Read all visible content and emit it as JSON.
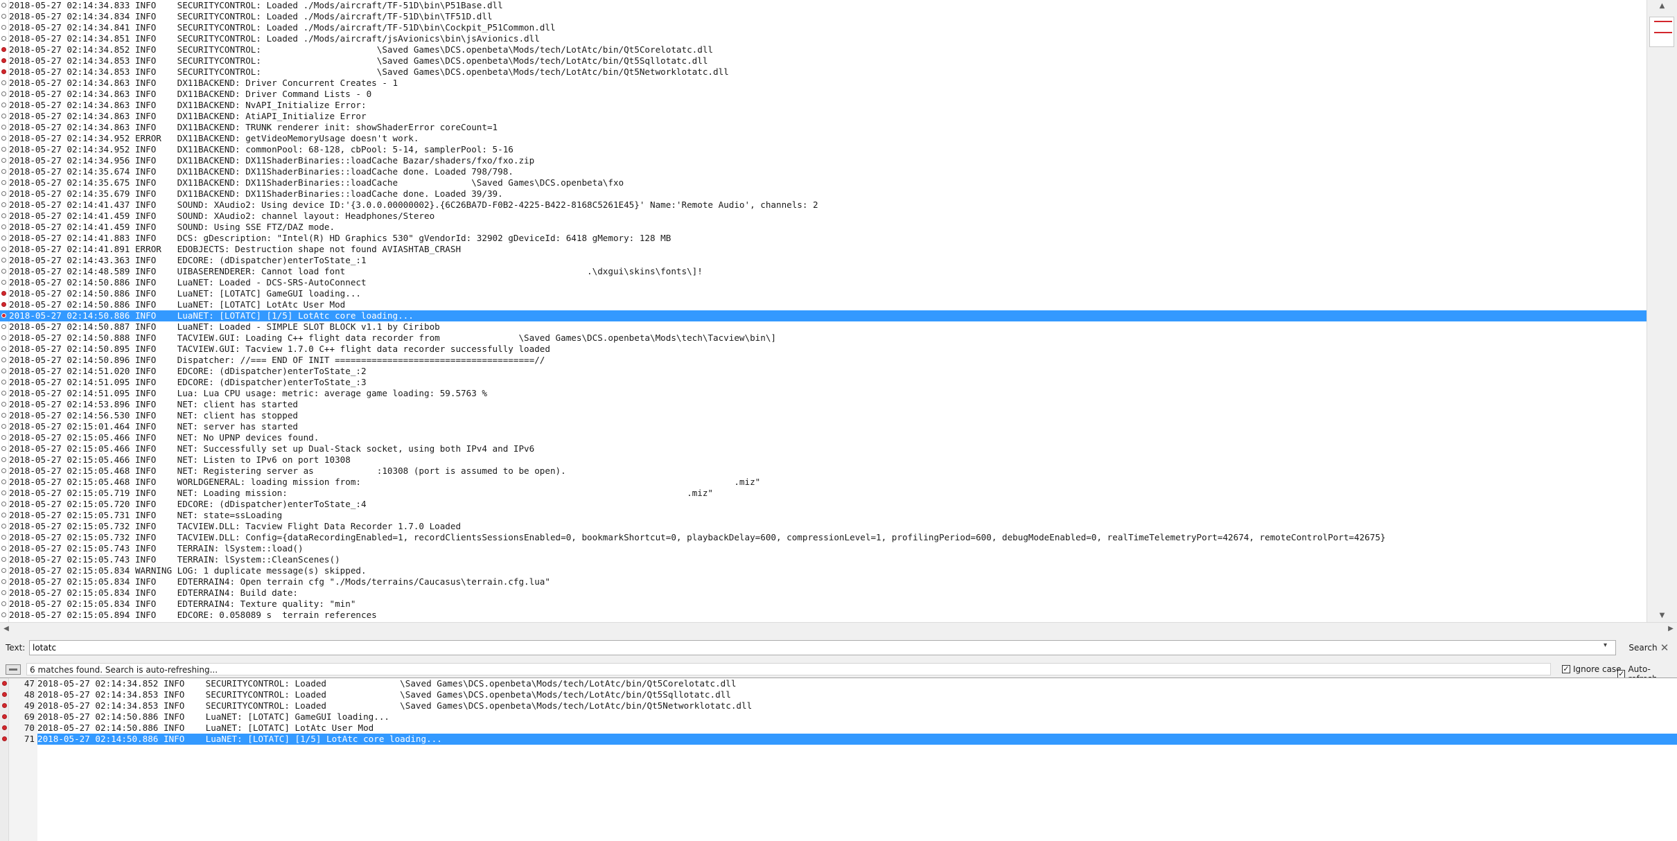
{
  "log": {
    "lines": [
      {
        "t": "2018-05-27 02:14:34.833 INFO    SECURITYCONTROL: Loaded ./Mods/aircraft/TF-51D\\bin\\P51Base.dll",
        "m": false
      },
      {
        "t": "2018-05-27 02:14:34.834 INFO    SECURITYCONTROL: Loaded ./Mods/aircraft/TF-51D\\bin\\TF51D.dll",
        "m": false
      },
      {
        "t": "2018-05-27 02:14:34.841 INFO    SECURITYCONTROL: Loaded ./Mods/aircraft/TF-51D\\bin\\Cockpit_P51Common.dll",
        "m": false
      },
      {
        "t": "2018-05-27 02:14:34.851 INFO    SECURITYCONTROL: Loaded ./Mods/aircraft/jsAvionics\\bin\\jsAvionics.dll",
        "m": false
      },
      {
        "t": "2018-05-27 02:14:34.852 INFO    SECURITYCONTROL:                      \\Saved Games\\DCS.openbeta\\Mods/tech/LotAtc/bin/Qt5Corelotatc.dll",
        "m": true
      },
      {
        "t": "2018-05-27 02:14:34.853 INFO    SECURITYCONTROL:                      \\Saved Games\\DCS.openbeta\\Mods/tech/LotAtc/bin/Qt5Sqllotatc.dll",
        "m": true
      },
      {
        "t": "2018-05-27 02:14:34.853 INFO    SECURITYCONTROL:                      \\Saved Games\\DCS.openbeta\\Mods/tech/LotAtc/bin/Qt5Networklotatc.dll",
        "m": true
      },
      {
        "t": "2018-05-27 02:14:34.863 INFO    DX11BACKEND: Driver Concurrent Creates - 1",
        "m": false
      },
      {
        "t": "2018-05-27 02:14:34.863 INFO    DX11BACKEND: Driver Command Lists - 0",
        "m": false
      },
      {
        "t": "2018-05-27 02:14:34.863 INFO    DX11BACKEND: NvAPI_Initialize Error:",
        "m": false
      },
      {
        "t": "2018-05-27 02:14:34.863 INFO    DX11BACKEND: AtiAPI_Initialize Error",
        "m": false
      },
      {
        "t": "2018-05-27 02:14:34.863 INFO    DX11BACKEND: TRUNK renderer init: showShaderError coreCount=1",
        "m": false
      },
      {
        "t": "2018-05-27 02:14:34.952 ERROR   DX11BACKEND: getVideoMemoryUsage doesn't work.",
        "m": false
      },
      {
        "t": "2018-05-27 02:14:34.952 INFO    DX11BACKEND: commonPool: 68-128, cbPool: 5-14, samplerPool: 5-16",
        "m": false
      },
      {
        "t": "2018-05-27 02:14:34.956 INFO    DX11BACKEND: DX11ShaderBinaries::loadCache Bazar/shaders/fxo/fxo.zip",
        "m": false
      },
      {
        "t": "2018-05-27 02:14:35.674 INFO    DX11BACKEND: DX11ShaderBinaries::loadCache done. Loaded 798/798.",
        "m": false
      },
      {
        "t": "2018-05-27 02:14:35.675 INFO    DX11BACKEND: DX11ShaderBinaries::loadCache              \\Saved Games\\DCS.openbeta\\fxo",
        "m": false
      },
      {
        "t": "2018-05-27 02:14:35.679 INFO    DX11BACKEND: DX11ShaderBinaries::loadCache done. Loaded 39/39.",
        "m": false
      },
      {
        "t": "2018-05-27 02:14:41.437 INFO    SOUND: XAudio2: Using device ID:'{3.0.0.00000002}.{6C26BA7D-F0B2-4225-B422-8168C5261E45}' Name:'Remote Audio', channels: 2",
        "m": false
      },
      {
        "t": "2018-05-27 02:14:41.459 INFO    SOUND: XAudio2: channel layout: Headphones/Stereo",
        "m": false
      },
      {
        "t": "2018-05-27 02:14:41.459 INFO    SOUND: Using SSE FTZ/DAZ mode.",
        "m": false
      },
      {
        "t": "2018-05-27 02:14:41.883 INFO    DCS: gDescription: \"Intel(R) HD Graphics 530\" gVendorId: 32902 gDeviceId: 6418 gMemory: 128 MB",
        "m": false
      },
      {
        "t": "2018-05-27 02:14:41.891 ERROR   EDOBJECTS: Destruction shape not found AVIASHTAB_CRASH",
        "m": false
      },
      {
        "t": "2018-05-27 02:14:43.363 INFO    EDCORE: (dDispatcher)enterToState_:1",
        "m": false
      },
      {
        "t": "2018-05-27 02:14:48.589 INFO    UIBASERENDERER: Cannot load font                                              .\\dxgui\\skins\\fonts\\]!",
        "m": false
      },
      {
        "t": "2018-05-27 02:14:50.886 INFO    LuaNET: Loaded - DCS-SRS-AutoConnect",
        "m": false
      },
      {
        "t": "2018-05-27 02:14:50.886 INFO    LuaNET: [LOTATC] GameGUI loading...",
        "m": true
      },
      {
        "t": "2018-05-27 02:14:50.886 INFO    LuaNET: [LOTATC] LotAtc User Mod",
        "m": true
      },
      {
        "t": "2018-05-27 02:14:50.886 INFO    LuaNET: [LOTATC] [1/5] LotAtc core loading...",
        "m": true,
        "sel": true
      },
      {
        "t": "2018-05-27 02:14:50.887 INFO    LuaNET: Loaded - SIMPLE SLOT BLOCK v1.1 by Ciribob",
        "m": false
      },
      {
        "t": "2018-05-27 02:14:50.888 INFO    TACVIEW.GUI: Loading C++ flight data recorder from               \\Saved Games\\DCS.openbeta\\Mods\\tech\\Tacview\\bin\\]",
        "m": false
      },
      {
        "t": "2018-05-27 02:14:50.895 INFO    TACVIEW.GUI: Tacview 1.7.0 C++ flight data recorder successfully loaded",
        "m": false
      },
      {
        "t": "2018-05-27 02:14:50.896 INFO    Dispatcher: //=== END OF INIT ======================================//",
        "m": false
      },
      {
        "t": "2018-05-27 02:14:51.020 INFO    EDCORE: (dDispatcher)enterToState_:2",
        "m": false
      },
      {
        "t": "2018-05-27 02:14:51.095 INFO    EDCORE: (dDispatcher)enterToState_:3",
        "m": false
      },
      {
        "t": "2018-05-27 02:14:51.095 INFO    Lua: Lua CPU usage: metric: average game loading: 59.5763 %",
        "m": false
      },
      {
        "t": "2018-05-27 02:14:53.896 INFO    NET: client has started",
        "m": false
      },
      {
        "t": "2018-05-27 02:14:56.530 INFO    NET: client has stopped",
        "m": false
      },
      {
        "t": "2018-05-27 02:15:01.464 INFO    NET: server has started",
        "m": false
      },
      {
        "t": "2018-05-27 02:15:05.466 INFO    NET: No UPNP devices found.",
        "m": false
      },
      {
        "t": "2018-05-27 02:15:05.466 INFO    NET: Successfully set up Dual-Stack socket, using both IPv4 and IPv6",
        "m": false
      },
      {
        "t": "2018-05-27 02:15:05.466 INFO    NET: Listen to IPv6 on port 10308",
        "m": false
      },
      {
        "t": "2018-05-27 02:15:05.468 INFO    NET: Registering server as            :10308 (port is assumed to be open).",
        "m": false
      },
      {
        "t": "2018-05-27 02:15:05.468 INFO    WORLDGENERAL: loading mission from:                                                                       .miz\"",
        "m": false
      },
      {
        "t": "2018-05-27 02:15:05.719 INFO    NET: Loading mission:                                                                            .miz\"",
        "m": false
      },
      {
        "t": "2018-05-27 02:15:05.720 INFO    EDCORE: (dDispatcher)enterToState_:4",
        "m": false
      },
      {
        "t": "2018-05-27 02:15:05.731 INFO    NET: state=ssLoading",
        "m": false
      },
      {
        "t": "2018-05-27 02:15:05.732 INFO    TACVIEW.DLL: Tacview Flight Data Recorder 1.7.0 Loaded",
        "m": false
      },
      {
        "t": "2018-05-27 02:15:05.732 INFO    TACVIEW.DLL: Config={dataRecordingEnabled=1, recordClientsSessionsEnabled=0, bookmarkShortcut=0, playbackDelay=600, compressionLevel=1, profilingPeriod=600, debugModeEnabled=0, realTimeTelemetryPort=42674, remoteControlPort=42675}",
        "m": false
      },
      {
        "t": "2018-05-27 02:15:05.743 INFO    TERRAIN: lSystem::load()",
        "m": false
      },
      {
        "t": "2018-05-27 02:15:05.743 INFO    TERRAIN: lSystem::CleanScenes()",
        "m": false
      },
      {
        "t": "2018-05-27 02:15:05.834 WARNING LOG: 1 duplicate message(s) skipped.",
        "m": false
      },
      {
        "t": "2018-05-27 02:15:05.834 INFO    EDTERRAIN4: Open terrain cfg \"./Mods/terrains/Caucasus\\terrain.cfg.lua\"",
        "m": false
      },
      {
        "t": "2018-05-27 02:15:05.834 INFO    EDTERRAIN4: Build date:",
        "m": false
      },
      {
        "t": "2018-05-27 02:15:05.834 INFO    EDTERRAIN4: Texture quality: \"min\"",
        "m": false
      },
      {
        "t": "2018-05-27 02:15:05.894 INFO    EDCORE: 0.058089 s  terrain references",
        "m": false
      }
    ]
  },
  "search": {
    "label": "Text:",
    "value": "lotatc",
    "button": "Search",
    "close": "✕",
    "dropdown": "▾"
  },
  "status": {
    "message": "6 matches found. Search is auto-refreshing...",
    "ignore_case": "Ignore case",
    "auto_refresh": "Auto-refresh",
    "check": "✓"
  },
  "results": [
    {
      "n": "47",
      "t": "2018-05-27 02:14:34.852 INFO    SECURITYCONTROL: Loaded              \\Saved Games\\DCS.openbeta\\Mods/tech/LotAtc/bin/Qt5Corelotatc.dll"
    },
    {
      "n": "48",
      "t": "2018-05-27 02:14:34.853 INFO    SECURITYCONTROL: Loaded              \\Saved Games\\DCS.openbeta\\Mods/tech/LotAtc/bin/Qt5Sqllotatc.dll"
    },
    {
      "n": "49",
      "t": "2018-05-27 02:14:34.853 INFO    SECURITYCONTROL: Loaded              \\Saved Games\\DCS.openbeta\\Mods/tech/LotAtc/bin/Qt5Networklotatc.dll"
    },
    {
      "n": "69",
      "t": "2018-05-27 02:14:50.886 INFO    LuaNET: [LOTATC] GameGUI loading..."
    },
    {
      "n": "70",
      "t": "2018-05-27 02:14:50.886 INFO    LuaNET: [LOTATC] LotAtc User Mod"
    },
    {
      "n": "71",
      "t": "2018-05-27 02:14:50.886 INFO    LuaNET: [LOTATC] [1/5] LotAtc core loading...",
      "sel": true
    }
  ],
  "scroll": {
    "up": "▲",
    "down": "▼",
    "left": "◀",
    "right": "▶"
  }
}
